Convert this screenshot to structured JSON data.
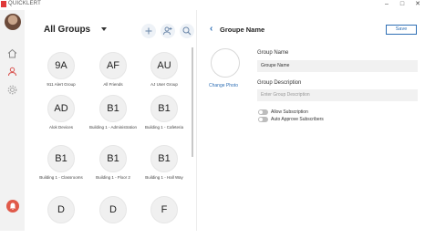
{
  "window": {
    "title": "QUICKLERT",
    "controls": {
      "minimize": "–",
      "maximize": "□",
      "close": "✕"
    }
  },
  "sidebar": {
    "items": [
      {
        "name": "home",
        "icon": "home-icon"
      },
      {
        "name": "groups",
        "icon": "people-icon",
        "active": true
      },
      {
        "name": "settings",
        "icon": "gear-icon"
      }
    ],
    "alert_icon": "bell-icon"
  },
  "groups": {
    "title": "All Groups",
    "actions": [
      "add-icon",
      "add-user-icon",
      "search-icon"
    ],
    "items": [
      {
        "initials": "9A",
        "name": "911 Alert Group"
      },
      {
        "initials": "AF",
        "name": "All Friends"
      },
      {
        "initials": "AU",
        "name": "AJ User Group"
      },
      {
        "initials": "AD",
        "name": "Alok Devices"
      },
      {
        "initials": "B1",
        "name": "Building 1 - Administration"
      },
      {
        "initials": "B1",
        "name": "Building 1 - Cafeteria"
      },
      {
        "initials": "B1",
        "name": "Building 1 - Classrooms"
      },
      {
        "initials": "B1",
        "name": "Building 1 - Floor 2"
      },
      {
        "initials": "B1",
        "name": "Building 1 - Hall Way"
      },
      {
        "initials": "D",
        "name": ""
      },
      {
        "initials": "D",
        "name": ""
      },
      {
        "initials": "F",
        "name": ""
      }
    ]
  },
  "detail": {
    "back_icon": "chevron-left-icon",
    "title": "Groupe Name",
    "save_label": "Save",
    "change_photo_label": "Change Photo",
    "group_name_label": "Group Name",
    "group_name_value": "Groupe Name",
    "group_description_label": "Group Description",
    "group_description_placeholder": "Enter Group Description",
    "allow_subscription_label": "Allow Subscription",
    "auto_approve_label": "Auto Approve Subscribers",
    "allow_subscription_on": false,
    "auto_approve_on": false
  },
  "colors": {
    "accent": "#2f6fb5",
    "sidebar_bg": "#f2f2f2",
    "alert": "#e05a4a",
    "logo": "#e03a3a"
  }
}
